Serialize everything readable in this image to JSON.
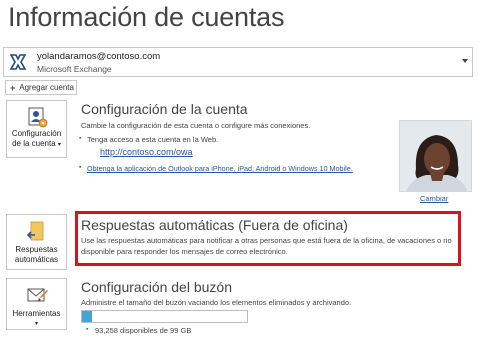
{
  "page": {
    "title": "Información de cuentas"
  },
  "account": {
    "email": "yolandaramos@contoso.com",
    "type": "Microsoft Exchange",
    "add_label": "Agregar cuenta"
  },
  "settings": {
    "button_line1": "Configuración",
    "button_line2": "de la cuenta",
    "title": "Configuración de la cuenta",
    "description": "Cambie la configuración de esta cuenta o configure más conexiones.",
    "web_access_text": "Tenga acceso a esta cuenta en la Web.",
    "owa_link": "http://contoso.com/owa",
    "mobile_link": "Obtenga la aplicación de Outlook para iPhone, iPad, Android o Windows 10 Mobile."
  },
  "profile": {
    "change_label": "Cambiar"
  },
  "auto_replies": {
    "button_line1": "Respuestas",
    "button_line2": "automáticas",
    "title": "Respuestas automáticas (Fuera de oficina)",
    "description": "Use las respuestas automáticas para notificar a otras personas que está fuera de la oficina, de vacaciones o no disponible para responder los mensajes de correo electrónico."
  },
  "mailbox": {
    "button_label": "Herramientas",
    "title": "Configuración del buzón",
    "description": "Administre el tamaño del buzón vaciando los elementos eliminados y archivando.",
    "quota_text": "93,258 disponibles de 99 GB",
    "used_fraction": 0.06
  },
  "colors": {
    "accent": "#2b579a",
    "highlight": "#d7141a",
    "progress": "#41a5d8"
  }
}
